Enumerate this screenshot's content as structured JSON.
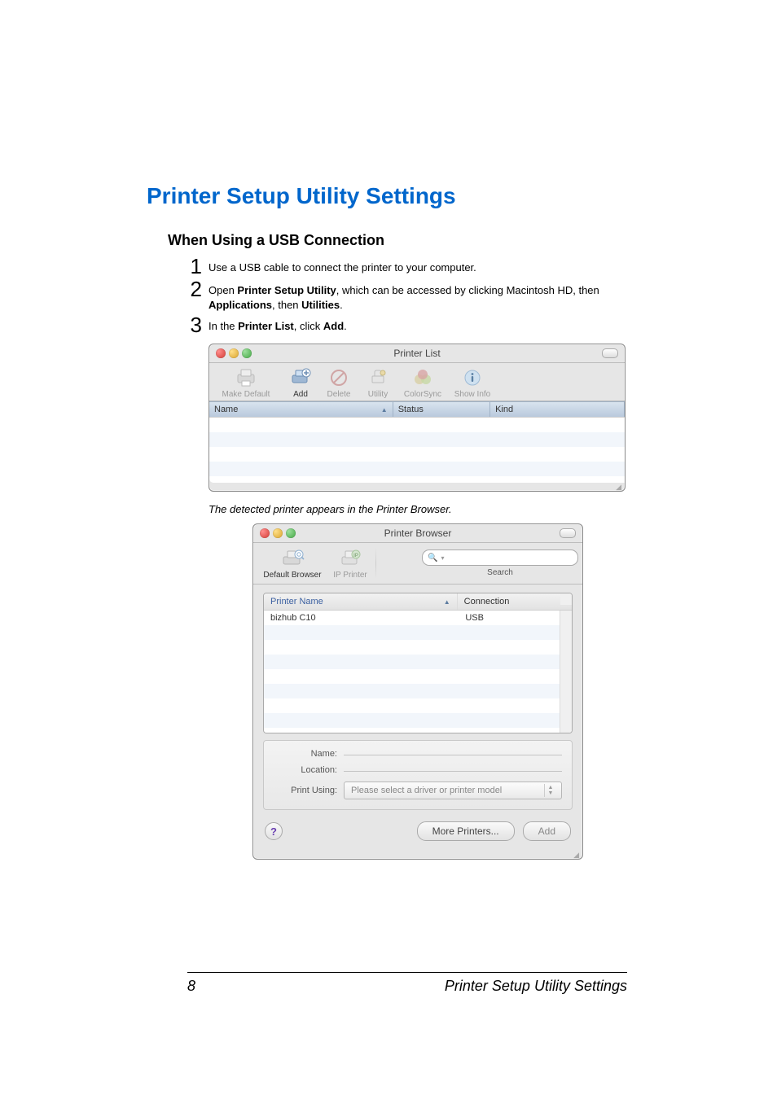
{
  "headings": {
    "h1": "Printer Setup Utility Settings",
    "h2": "When Using a USB Connection"
  },
  "steps": {
    "s1": "Use a USB cable to connect the printer to your computer.",
    "s2_pre": "Open ",
    "s2_b1": "Printer Setup Utility",
    "s2_mid": ", which can be accessed by clicking Macintosh HD, then ",
    "s2_b2": "Applications",
    "s2_mid2": ", then ",
    "s2_b3": "Utilities",
    "s2_end": ".",
    "s3_pre": "In the ",
    "s3_b1": "Printer List",
    "s3_mid": ", click ",
    "s3_b2": "Add",
    "s3_end": "."
  },
  "numbers": {
    "n1": "1",
    "n2": "2",
    "n3": "3"
  },
  "note": "The detected printer appears in the Printer Browser.",
  "printer_list": {
    "title": "Printer List",
    "toolbar": {
      "make_default": "Make Default",
      "add": "Add",
      "delete": "Delete",
      "utility": "Utility",
      "colorsync": "ColorSync",
      "show_info": "Show Info"
    },
    "columns": {
      "name": "Name",
      "status": "Status",
      "kind": "Kind"
    }
  },
  "printer_browser": {
    "title": "Printer Browser",
    "tabs": {
      "default_browser": "Default Browser",
      "ip_printer": "IP Printer"
    },
    "search_placeholder": "",
    "search_label": "Search",
    "columns": {
      "printer_name": "Printer Name",
      "connection": "Connection"
    },
    "row": {
      "name": "bizhub C10",
      "connection": "USB"
    },
    "form": {
      "name_label": "Name:",
      "location_label": "Location:",
      "print_using_label": "Print Using:",
      "print_using_value": "Please select a driver or printer model"
    },
    "buttons": {
      "more_printers": "More Printers...",
      "add": "Add",
      "help": "?"
    },
    "search_glyph": "Q"
  },
  "footer": {
    "page": "8",
    "title": "Printer Setup Utility Settings"
  }
}
